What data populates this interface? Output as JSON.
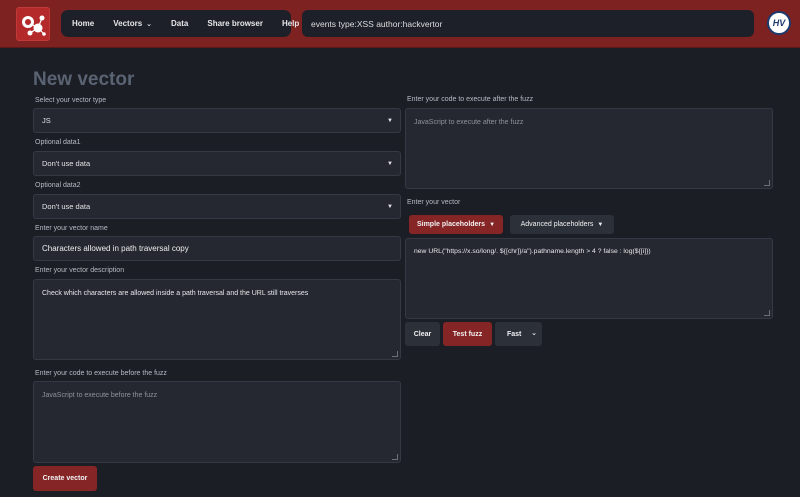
{
  "header": {
    "logo_icon": "bubbles-logo-icon",
    "nav": [
      {
        "label": "Home",
        "has_dropdown": false
      },
      {
        "label": "Vectors",
        "has_dropdown": true
      },
      {
        "label": "Data",
        "has_dropdown": false
      },
      {
        "label": "Share browser",
        "has_dropdown": false
      },
      {
        "label": "Help",
        "has_dropdown": false
      }
    ],
    "search_value": "events type:XSS author:hackvertor",
    "avatar_text": "HV"
  },
  "page": {
    "title": "New vector"
  },
  "form": {
    "vector_type": {
      "label": "Select your vector type",
      "value": "JS"
    },
    "data1": {
      "label": "Optional data1",
      "value": "Don't use data"
    },
    "data2": {
      "label": "Optional data2",
      "value": "Don't use data"
    },
    "name": {
      "label": "Enter your vector name",
      "value": "Characters allowed in path traversal copy"
    },
    "description": {
      "label": "Enter your vector description",
      "value": "Check which characters are allowed inside a path traversal and the URL still traverses"
    },
    "before_fuzz": {
      "label": "Enter your code to execute before the fuzz",
      "placeholder": "JavaScript to execute before the fuzz"
    },
    "after_fuzz": {
      "label": "Enter your code to execute after the fuzz",
      "placeholder": "JavaScript to execute after the fuzz"
    },
    "vector": {
      "label": "Enter your vector",
      "value": "new URL(\"https://x.so/long/. ${[chr]}/a\").pathname.length > 4 ?  false : log(${[i]})"
    },
    "simple_placeholders_label": "Simple placeholders",
    "advanced_placeholders_label": "Advanced placeholders",
    "clear_label": "Clear",
    "test_fuzz_label": "Test fuzz",
    "speed_value": "Fast",
    "create_label": "Create vector"
  },
  "colors": {
    "header_bg": "#7d2121",
    "accent_red": "#862525",
    "page_bg": "#1b1e25",
    "field_bg": "#252830"
  }
}
